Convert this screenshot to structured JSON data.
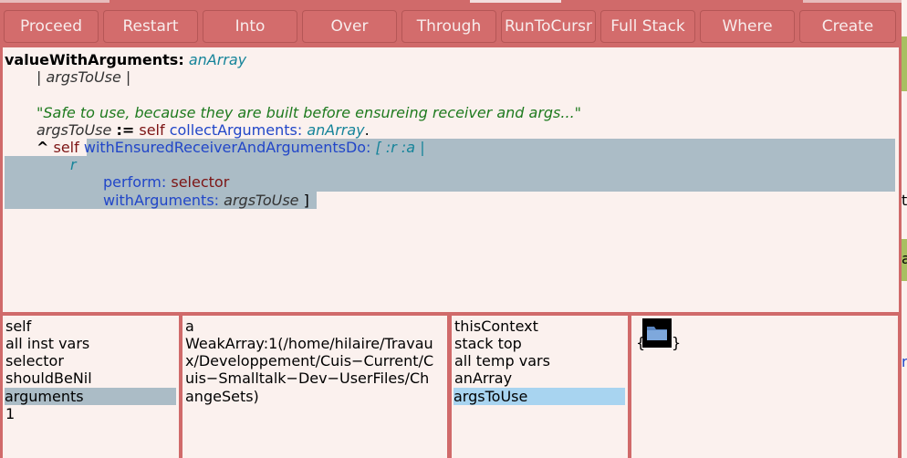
{
  "toolbar": {
    "buttons": [
      "Proceed",
      "Restart",
      "Into",
      "Over",
      "Through",
      "RunToCursr",
      "Full Stack",
      "Where",
      "Create"
    ]
  },
  "code": {
    "selector": "valueWithArguments:",
    "arg": "anArray",
    "temps": "| argsToUse |",
    "comment": "\"Safe to use, because they are built before ensureing receiver and args...\"",
    "line4_var": "argsToUse",
    "line4_assign": ":=",
    "line4_self": "self",
    "line4_msg": "collectArguments:",
    "line4_arg": "anArray",
    "line4_end": ".",
    "line5_caret": "^",
    "line5_self": "self",
    "line5_msg": "withEnsuredReceiverAndArgumentsDo:",
    "line5_block": "[ :r :a |",
    "line6_r": "r",
    "line7_msg": "perform:",
    "line7_arg": "selector",
    "line8_msg": "withArguments:",
    "line8_arg": "argsToUse",
    "line8_end": "]"
  },
  "receiver_pane": {
    "items": [
      "self",
      "all inst vars",
      "selector",
      "shouldBeNil",
      "arguments",
      "1"
    ],
    "selected": "arguments"
  },
  "value_pane": {
    "lines": [
      "a",
      "WeakArray:1(/home/hilaire/Travau",
      "x/Developpement/Cuis−Current/C",
      "uis−Smalltalk−Dev−UserFiles/Ch",
      "angeSets)"
    ]
  },
  "context_pane": {
    "items": [
      "thisContext",
      "stack top",
      "all temp vars",
      "anArray",
      "argsToUse"
    ],
    "selected": "argsToUse"
  },
  "context_value_pane": {
    "open_brace": "{",
    "close_brace": "}",
    "icon": "folder-icon"
  },
  "right_edge": {
    "chars": [
      "t",
      "a",
      "r"
    ]
  }
}
